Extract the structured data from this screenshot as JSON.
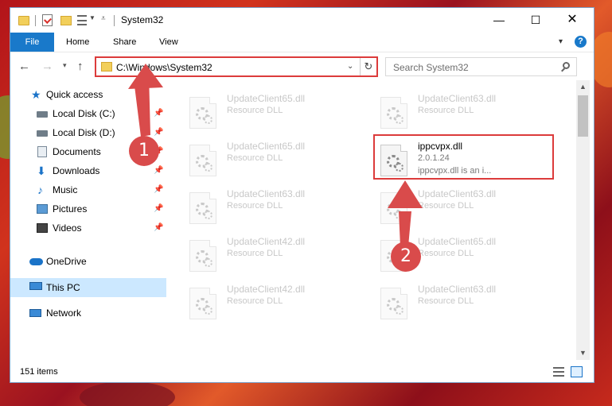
{
  "window": {
    "title": "System32",
    "controls": {
      "minimize": "—",
      "maximize": "☐",
      "close": "✕"
    }
  },
  "ribbon": {
    "tabs": [
      "File",
      "Home",
      "Share",
      "View"
    ],
    "help": "?"
  },
  "address_bar": {
    "path": "C:\\Windows\\System32",
    "search_placeholder": "Search System32"
  },
  "navigation_pane": {
    "items": [
      {
        "label": "Quick access",
        "icon": "star-icon",
        "pinned": false
      },
      {
        "label": "Local Disk (C:)",
        "icon": "disk-icon",
        "pinned": true
      },
      {
        "label": "Local Disk (D:)",
        "icon": "disk-icon",
        "pinned": true
      },
      {
        "label": "Documents",
        "icon": "documents-icon",
        "pinned": true
      },
      {
        "label": "Downloads",
        "icon": "download-icon",
        "pinned": true
      },
      {
        "label": "Music",
        "icon": "music-icon",
        "pinned": true
      },
      {
        "label": "Pictures",
        "icon": "pictures-icon",
        "pinned": true
      },
      {
        "label": "Videos",
        "icon": "videos-icon",
        "pinned": true
      },
      {
        "label": "OneDrive",
        "icon": "onedrive-icon",
        "pinned": false
      },
      {
        "label": "This PC",
        "icon": "this-pc-icon",
        "pinned": false,
        "selected": true
      },
      {
        "label": "Network",
        "icon": "network-icon",
        "pinned": false
      }
    ]
  },
  "files": [
    {
      "name": "UpdateClient65.dll",
      "type": "Resource DLL"
    },
    {
      "name": "UpdateClient63.dll",
      "type": "Resource DLL"
    },
    {
      "name": "UpdateClient65.dll",
      "type": "Resource DLL"
    },
    {
      "name": "ippcvpx.dll",
      "version": "2.0.1.24",
      "description": "ippcvpx.dll is an i...",
      "selected": true
    },
    {
      "name": "UpdateClient63.dll",
      "type": "Resource DLL"
    },
    {
      "name": "UpdateClient63.dll",
      "type": "Resource DLL"
    },
    {
      "name": "UpdateClient42.dll",
      "type": "Resource DLL"
    },
    {
      "name": "UpdateClient65.dll",
      "type": "Resource DLL"
    },
    {
      "name": "UpdateClient42.dll",
      "type": "Resource DLL"
    },
    {
      "name": "UpdateClient63.dll",
      "type": "Resource DLL"
    }
  ],
  "status_bar": {
    "item_count": "151 items"
  },
  "annotations": {
    "step1": "1",
    "step2": "2"
  },
  "colors": {
    "accent": "#1979ca",
    "annotation": "#dc3b3b"
  }
}
